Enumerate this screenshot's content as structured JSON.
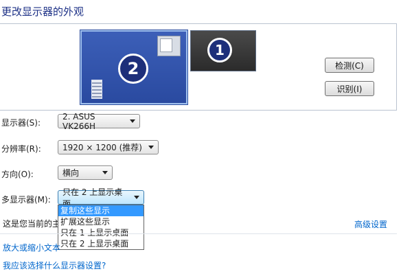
{
  "window": {
    "title": "更改显示器的外观"
  },
  "preview": {
    "monitor_2_number": "2",
    "monitor_1_number": "1",
    "detect_button": "检测(C)",
    "identify_button": "识别(I)"
  },
  "settings": {
    "display_label": "显示器(S):",
    "display_value": "2. ASUS VK266H",
    "resolution_label": "分辨率(R):",
    "resolution_value": "1920 × 1200 (推荐)",
    "orientation_label": "方向(O):",
    "orientation_value": "横向",
    "multi_label": "多显示器(M):",
    "multi_value": "只在 2 上显示桌面",
    "multi_options": [
      "复制这些显示",
      "扩展这些显示",
      "只在 1 上显示桌面",
      "只在 2 上显示桌面"
    ]
  },
  "status_text": "这是您当前的主",
  "links": {
    "advanced": "高级设置",
    "text_size": "放大或缩小文本",
    "which_settings": "我应该选择什么显示器设置?"
  }
}
